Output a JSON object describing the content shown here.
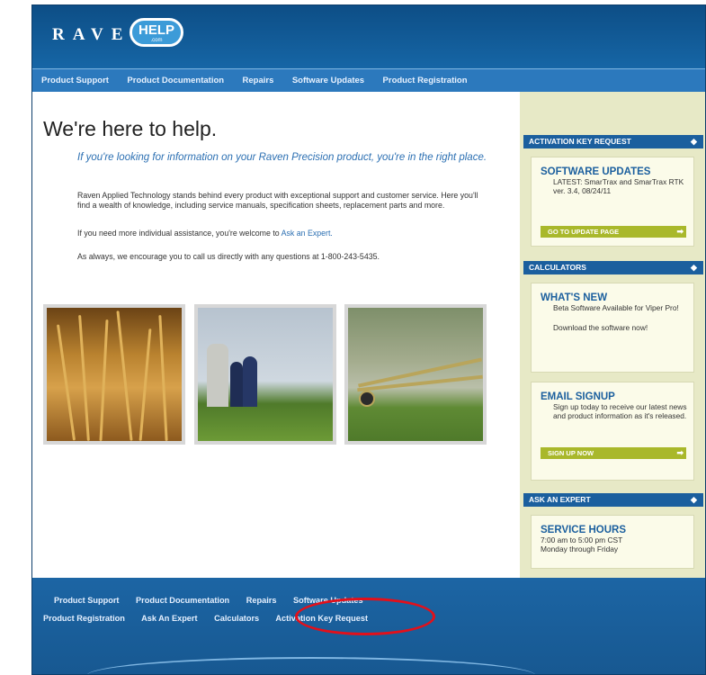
{
  "header": {
    "brand": "RAVEN",
    "help_badge": "HELP",
    "help_sub": ".com"
  },
  "nav": {
    "items": [
      "Product Support",
      "Product Documentation",
      "Repairs",
      "Software Updates",
      "Product Registration"
    ]
  },
  "main": {
    "title": "We're here to help.",
    "intro": "If you're looking for information on your Raven Precision product, you're in the right place.",
    "para1": "Raven Applied Technology stands behind every product with exceptional support and customer service. Here you'll find a wealth of knowledge, including service manuals, specification sheets, replacement parts and more.",
    "para2_prefix": "If you need more individual assistance, you're welcome to ",
    "para2_link": "Ask an Expert.",
    "para3": "As always, we encourage you to call us directly with any questions at 1-800-243-5435."
  },
  "sidebar": {
    "activation_bar": "ACTIVATION KEY REQUEST",
    "software": {
      "title": "SOFTWARE UPDATES",
      "text": "LATEST: SmarTrax and SmarTrax RTK ver. 3.4, 08/24/11",
      "button": "GO TO UPDATE PAGE"
    },
    "calculators_bar": "CALCULATORS",
    "whats_new": {
      "title": "WHAT'S NEW",
      "text": "Beta Software Available for Viper Pro!",
      "text2": "Download the software now!"
    },
    "email": {
      "title": "EMAIL SIGNUP",
      "text": "Sign up today to receive our latest news and product information as it's released.",
      "button": "SIGN UP NOW"
    },
    "expert_bar": "ASK AN EXPERT",
    "service": {
      "title": "SERVICE HOURS",
      "text": "7:00 am to 5:00 pm CST",
      "text2": "Monday through Friday"
    }
  },
  "footer": {
    "row1": [
      "Product Support",
      "Product Documentation",
      "Repairs",
      "Software Updates"
    ],
    "row2": [
      "Product Registration",
      "Ask An Expert",
      "Calculators",
      "Activation Key Request"
    ]
  },
  "annotation_color": "#e3101a"
}
